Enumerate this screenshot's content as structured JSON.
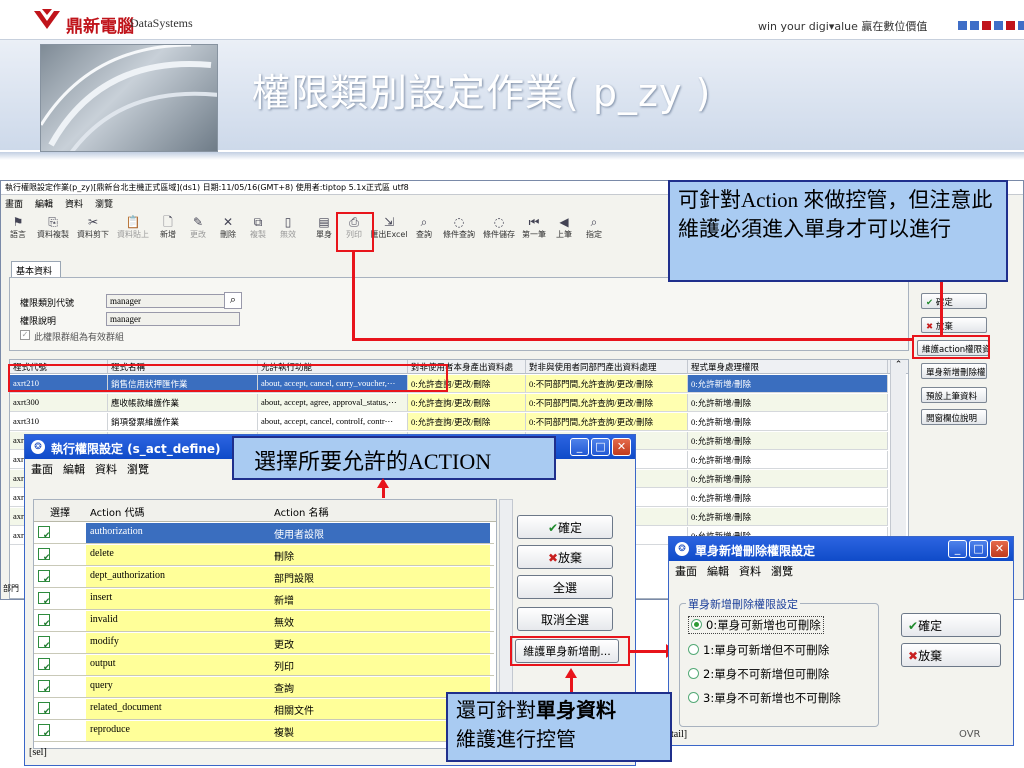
{
  "header": {
    "logo_cn": "鼎新電腦",
    "logo_en": "DataSystems",
    "slogan": "win your digi▾alue 贏在數位價值",
    "title": "權限類別設定作業( p_zy )"
  },
  "colors": {
    "brand_red": "#c0141b",
    "accent_blue": "#3a6ebf",
    "callout_blue": "#a9cbf2",
    "annotation_red": "#e8141b",
    "highlight_yellow": "#ffffb0"
  },
  "main_window": {
    "title": "執行權限設定作業(p_zy)[鼎新台北主機正式區域](ds1) 日期:11/05/16(GMT+8) 使用者:tiptop 5.1x正式區 utf8",
    "menu": [
      "畫面",
      "編輯",
      "資料",
      "瀏覽"
    ],
    "toolbar": [
      {
        "label": "語言",
        "icon": "flag-icon"
      },
      {
        "label": "資料複製",
        "icon": "copy-icon"
      },
      {
        "label": "資料剪下",
        "icon": "cut-icon"
      },
      {
        "label": "資料貼上",
        "icon": "paste-icon"
      },
      {
        "label": "新增",
        "icon": "new-doc-icon"
      },
      {
        "label": "更改",
        "icon": "pencil-icon"
      },
      {
        "label": "刪除",
        "icon": "delete-x-icon"
      },
      {
        "label": "複製",
        "icon": "duplicate-icon"
      },
      {
        "label": "無效",
        "icon": "invalid-icon"
      },
      {
        "label": "單身",
        "icon": "detail-icon"
      },
      {
        "label": "列印",
        "icon": "printer-icon"
      },
      {
        "label": "匯出Excel",
        "icon": "export-icon"
      },
      {
        "label": "查詢",
        "icon": "binoculars-icon"
      },
      {
        "label": "條件查詢",
        "icon": "filter-icon"
      },
      {
        "label": "條件儲存",
        "icon": "save-filter-icon"
      },
      {
        "label": "第一筆",
        "icon": "first-record-icon"
      },
      {
        "label": "上筆",
        "icon": "prev-record-icon"
      },
      {
        "label": "指定",
        "icon": "goto-icon"
      }
    ],
    "tab": "基本資料",
    "form": {
      "category_code_label": "權限類別代號",
      "category_code_value": "manager",
      "description_label": "權限說明",
      "description_value": "manager",
      "group_checkbox_label": "此權限群組為有效群組"
    },
    "grid": {
      "headers": [
        "程式代號",
        "程式名稱",
        "允許執行功能",
        "對非使用者本身產出資料處",
        "對非與使用者同部門產出資料處理",
        "程式單身處理權限"
      ],
      "rows": [
        [
          "axrt210",
          "銷售信用狀押匯作業",
          "about, accept, cancel, carry_voucher,⋯",
          "0:允許查詢/更改/刪除",
          "0:不同部門間,允許查詢/更改/刪除",
          "0:允許新增/刪除"
        ],
        [
          "axrt300",
          "應收帳款維護作業",
          "about, accept, agree, approval_status,⋯",
          "0:允許查詢/更改/刪除",
          "0:不同部門間,允許查詢/更改/刪除",
          "0:允許新增/刪除"
        ],
        [
          "axrt310",
          "銷項發票維護作業",
          "about, accept, cancel, controlf, contr⋯",
          "0:允許查詢/更改/刪除",
          "0:不同部門間,允許查詢/更改/刪除",
          "0:允許新增/刪除"
        ],
        [
          "axrt",
          "",
          "",
          "",
          "改/刪除",
          "0:允許新增/刪除"
        ],
        [
          "axrt",
          "",
          "",
          "",
          "改/刪除",
          "0:允許新增/刪除"
        ],
        [
          "axrt",
          "",
          "",
          "",
          "改/刪除",
          "0:允許新增/刪除"
        ],
        [
          "axrt",
          "",
          "",
          "",
          "改/刪除",
          "0:允許新增/刪除"
        ],
        [
          "axrt",
          "",
          "",
          "",
          "改/刪除",
          "0:允許新增/刪除"
        ],
        [
          "axrt",
          "",
          "",
          "",
          "改/刪除",
          "0:允許新增/刪除"
        ]
      ]
    },
    "side_buttons": [
      "確定",
      "放棄",
      "維護action權限資料",
      "單身新增刪除權",
      "預設上筆資料",
      "開窗欄位說明"
    ],
    "left_fragment": "部門"
  },
  "act_window": {
    "title": "執行權限設定 (s_act_define)",
    "menu": [
      "畫面",
      "編輯",
      "資料",
      "瀏覽"
    ],
    "headers": [
      "選擇",
      "Action 代碼",
      "Action 名稱"
    ],
    "rows": [
      {
        "code": "authorization",
        "name": "使用者設限"
      },
      {
        "code": "delete",
        "name": "刪除"
      },
      {
        "code": "dept_authorization",
        "name": "部門設限"
      },
      {
        "code": "insert",
        "name": "新增"
      },
      {
        "code": "invalid",
        "name": "無效"
      },
      {
        "code": "modify",
        "name": "更改"
      },
      {
        "code": "output",
        "name": "列印"
      },
      {
        "code": "query",
        "name": "查詢"
      },
      {
        "code": "related_document",
        "name": "相關文件"
      },
      {
        "code": "reproduce",
        "name": "複製"
      }
    ],
    "buttons": [
      "確定",
      "放棄",
      "全選",
      "取消全選",
      "維護單身新增刪..."
    ],
    "status": "[sel]"
  },
  "detail_window": {
    "title": "單身新增刪除權限設定",
    "menu": [
      "畫面",
      "編輯",
      "資料",
      "瀏覽"
    ],
    "group_label": "單身新增刪除權限設定",
    "options": [
      "0:單身可新增也可刪除",
      "1:單身可新增但不可刪除",
      "2:單身不可新增但可刪除",
      "3:單身不可新增也不可刪除"
    ],
    "buttons": [
      "確定",
      "放棄"
    ],
    "status_left": "tail]",
    "status_right": "OVR"
  },
  "callouts": {
    "top_right": "可針對Action 來做控管，但注意此維護必須進入單身才可以進行",
    "middle": "選擇所要允許的ACTION",
    "bottom_prefix": "還可針對",
    "bottom_bold": "單身資料",
    "bottom_suffix": "維護進行控管"
  }
}
